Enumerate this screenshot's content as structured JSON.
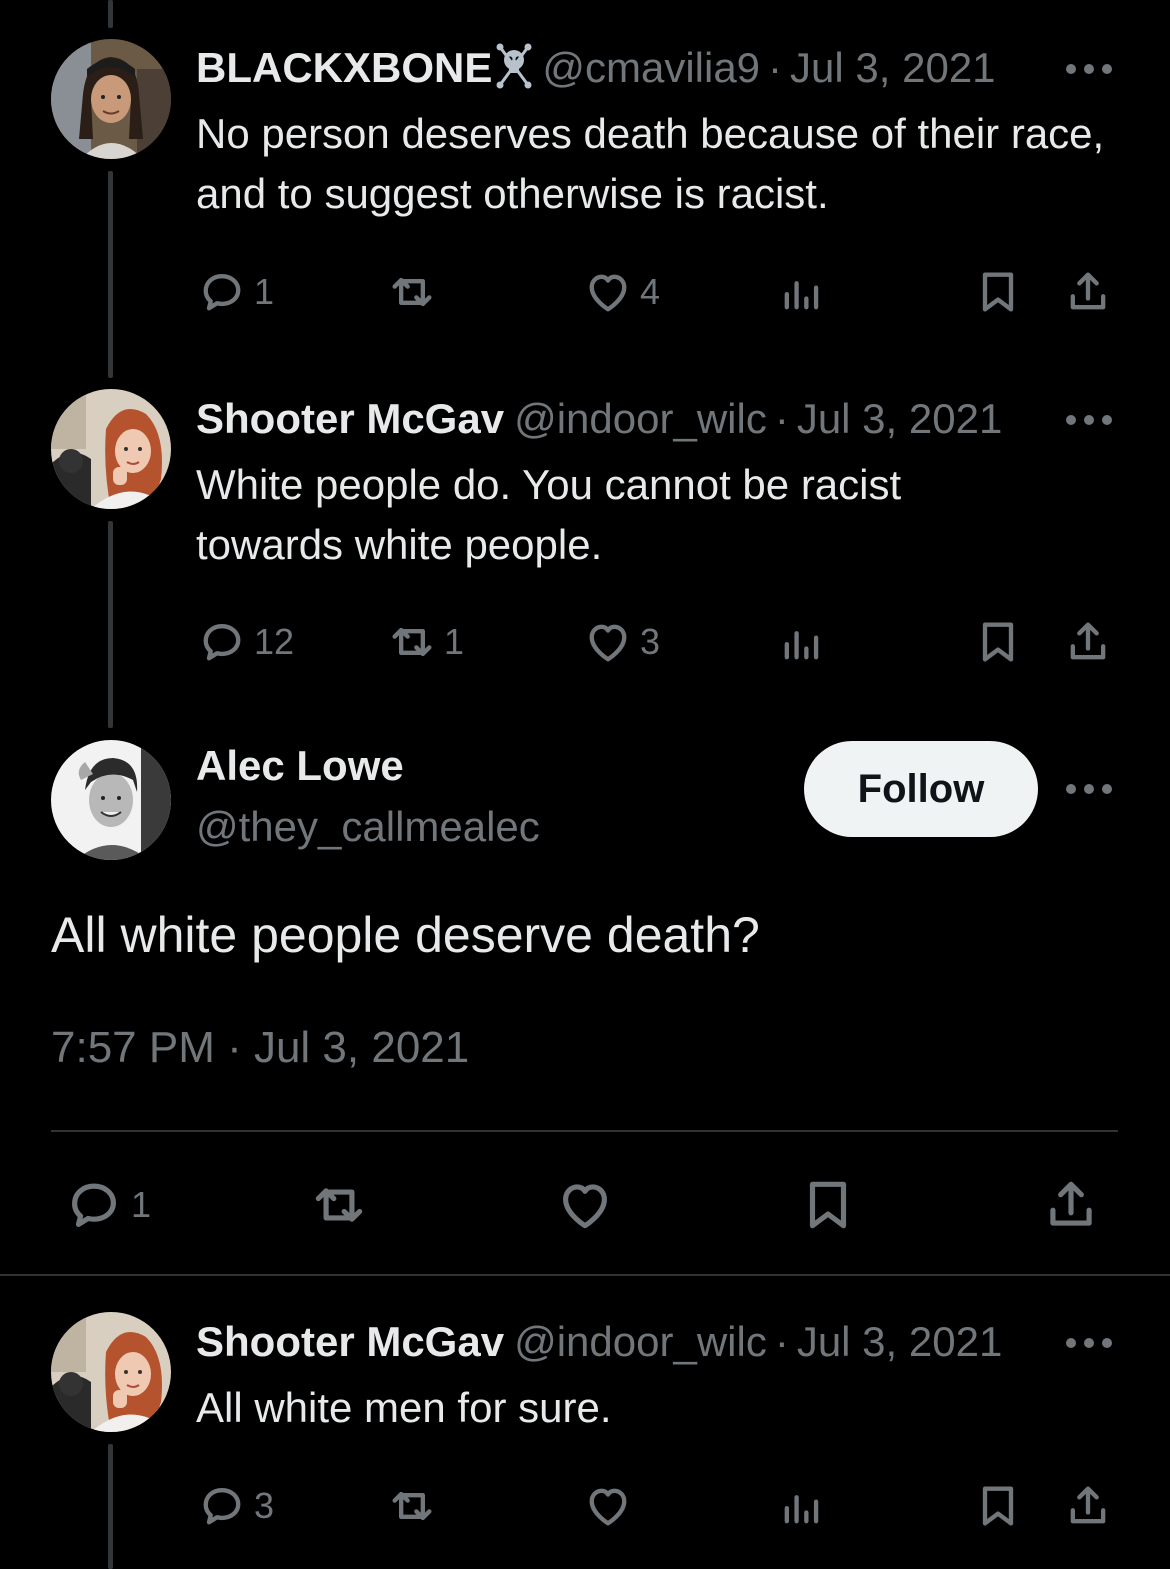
{
  "thread": [
    {
      "name": "BLACKXBONE",
      "name_badge": "skull-crossbones-emoji",
      "handle": "@cmavilia9",
      "separator": "·",
      "date": "Jul 3, 2021",
      "text": "No person deserves death because of their race, and to suggest otherwise is racist.",
      "replies": "1",
      "reposts": "",
      "likes": "4"
    },
    {
      "name": "Shooter McGav",
      "handle": "@indoor_wilc",
      "separator": "·",
      "date": "Jul 3, 2021",
      "text": "White people do. You cannot be racist towards white people.",
      "replies": "12",
      "reposts": "1",
      "likes": "3"
    }
  ],
  "focus": {
    "name": "Alec Lowe",
    "handle": "@they_callmealec",
    "follow_label": "Follow",
    "text": "All white people deserve death?",
    "timestamp": "7:57 PM · Jul 3, 2021",
    "replies": "1"
  },
  "reply": {
    "name": "Shooter McGav",
    "handle": "@indoor_wilc",
    "separator": "·",
    "date": "Jul 3, 2021",
    "text": "All white men for sure.",
    "replies": "3"
  },
  "colors": {
    "background": "#000000",
    "text": "#e7e9ea",
    "secondary": "#71767b",
    "follow_bg": "#eff3f4"
  }
}
